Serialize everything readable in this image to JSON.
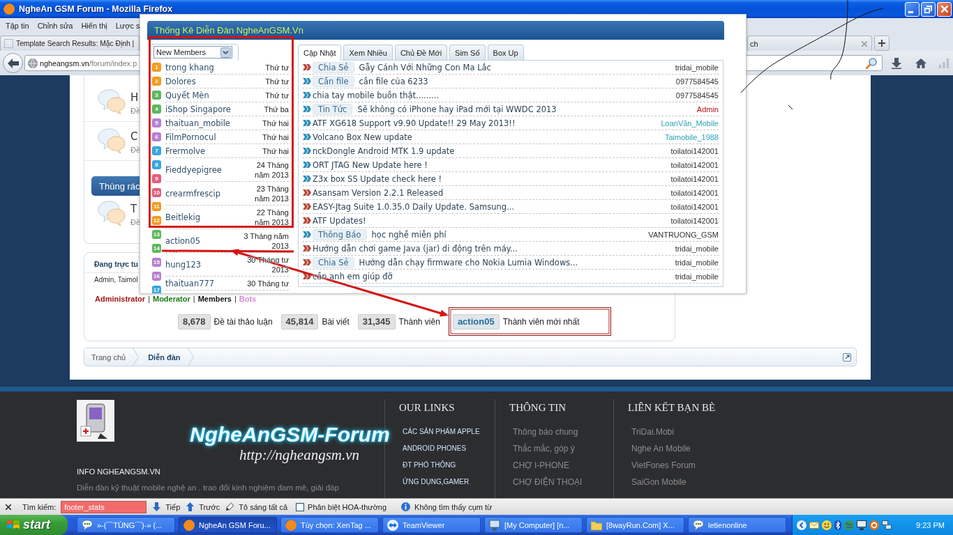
{
  "window": {
    "title": "NgheAn GSM Forum - Mozilla Firefox"
  },
  "menu_bar": [
    "Tập tin",
    "Chỉnh sửa",
    "Hiển thị",
    "Lược s"
  ],
  "browser_tabs": [
    {
      "label": "Template Search Results: Mặc Định |",
      "selected": false
    },
    {
      "label": "ch",
      "selected": false
    }
  ],
  "address_bar": {
    "host": "ngheangsm.vn",
    "path": "/forum/index.p"
  },
  "forum_list": {
    "nodes": [
      {
        "title": "H",
        "meta": "Đề"
      },
      {
        "title": "C",
        "meta": "Đề"
      }
    ],
    "category": {
      "title": "Thùng rác",
      "nodes": [
        {
          "title": "T",
          "meta": "Đề"
        }
      ]
    }
  },
  "online_box": {
    "title": "Đang trực tu",
    "members": "Admin, Taimol"
  },
  "legend": {
    "separator": "|",
    "items": [
      {
        "label": "Administrator",
        "color": "#a31515"
      },
      {
        "label": "Moderator",
        "color": "#1a7a12"
      },
      {
        "label": "Members",
        "color": "#111111"
      },
      {
        "label": "Bots",
        "color": "#d58cd5"
      }
    ]
  },
  "stats": [
    {
      "kind": "count",
      "number": "8,678",
      "caption": "Đề tài thảo luận"
    },
    {
      "kind": "count",
      "number": "45,814",
      "caption": "Bài viết"
    },
    {
      "kind": "count",
      "number": "31,345",
      "caption": "Thành viên"
    },
    {
      "kind": "member",
      "number": "action05",
      "caption": "Thành viên mới nhất"
    }
  ],
  "breadcrumb": [
    {
      "label": "Trang chủ",
      "current": false
    },
    {
      "label": "Diễn đàn",
      "current": true
    }
  ],
  "popup": {
    "title": "Thống Kê Diễn Đàn NgheAnGSM.Vn",
    "dropdown": "New Members",
    "badges": [
      {
        "number": "1",
        "color": "#f29c1f"
      },
      {
        "number": "2",
        "color": "#f29c1f"
      },
      {
        "number": "3",
        "color": "#5cb85c"
      },
      {
        "number": "4",
        "color": "#5cb85c"
      },
      {
        "number": "5",
        "color": "#b77fd1"
      },
      {
        "number": "6",
        "color": "#b77fd1"
      },
      {
        "number": "7",
        "color": "#38a8e0"
      },
      {
        "number": "8",
        "color": "#38a8e0"
      },
      {
        "number": "9",
        "color": "#e0607e"
      },
      {
        "number": "10",
        "color": "#e0607e"
      },
      {
        "number": "11",
        "color": "#f29c1f"
      },
      {
        "number": "12",
        "color": "#f29c1f"
      },
      {
        "number": "13",
        "color": "#5cb85c"
      },
      {
        "number": "14",
        "color": "#5cb85c"
      },
      {
        "number": "15",
        "color": "#b77fd1"
      },
      {
        "number": "16",
        "color": "#b77fd1"
      },
      {
        "number": "17",
        "color": "#38a8e0"
      }
    ],
    "members": [
      {
        "name": "trong khang",
        "date": "Thứ tư"
      },
      {
        "name": "Dolores",
        "date": "Thứ tư"
      },
      {
        "name": "Quyết Mèn",
        "date": "Thứ tư"
      },
      {
        "name": "iShop Singapore",
        "date": "Thứ ba"
      },
      {
        "name": "thaituan_mobile",
        "date": "Thứ hai"
      },
      {
        "name": "FilmPornocul",
        "date": "Thứ hai"
      },
      {
        "name": "Frermolve",
        "date": "Thứ hai"
      },
      {
        "name": "Fieddyepigree",
        "date": "24 Tháng năm 2013"
      },
      {
        "name": "crearmfrescip",
        "date": "23 Tháng năm 2013"
      },
      {
        "name": "Beitlekig",
        "date": "22 Tháng năm 2013"
      },
      {
        "name": "action05",
        "date": "3 Tháng năm 2013"
      },
      {
        "name": "hung123",
        "date": "30 Tháng tư 2013"
      },
      {
        "name": "thaituan777",
        "date": "30 Tháng tư"
      }
    ],
    "tabs": [
      {
        "label": "Cập Nhật",
        "selected": true
      },
      {
        "label": "Xem Nhiều",
        "selected": false
      },
      {
        "label": "Chủ Đề Mới",
        "selected": false
      },
      {
        "label": "Sim Số",
        "selected": false
      },
      {
        "label": "Box Up",
        "selected": false
      }
    ],
    "threads": [
      {
        "color": "#b5483a",
        "prefix": "Chia Sẻ",
        "title": "Gẫy Cánh Với Những Con Ma Lắc",
        "author": {
          "name": "tridai_mobile",
          "color": "#333333"
        }
      },
      {
        "color": "#2d8fb8",
        "prefix": "Cần file",
        "title": "cần file của 6233",
        "author": {
          "name": "0977584545",
          "color": "#333333"
        }
      },
      {
        "color": "#2d8fb8",
        "title": "chia tay mobile buồn thật.........",
        "author": {
          "name": "0977584545",
          "color": "#333333"
        }
      },
      {
        "color": "#2d8fb8",
        "prefix": "Tin Tức",
        "title": "Sẽ không có iPhone hay iPad mới tại WWDC 2013",
        "author": {
          "name": "Admin",
          "color": "#b01010"
        }
      },
      {
        "color": "#2d8fb8",
        "title": "ATF XG618 Support v9.90 Update!! 29 May 2013!!",
        "author": {
          "name": "LoanVăn_Mobile",
          "color": "#2aa3b8"
        }
      },
      {
        "color": "#2d8fb8",
        "title": "Volcano Box New update",
        "author": {
          "name": "Taimobile_1988",
          "color": "#2aa3b8"
        }
      },
      {
        "color": "#2d8fb8",
        "title": "nckDongle Android MTK 1.9 update",
        "author": {
          "name": "toilatoi142001",
          "color": "#333333"
        }
      },
      {
        "color": "#2d8fb8",
        "title": "ORT JTAG New Update here !",
        "author": {
          "name": "toilatoi142001",
          "color": "#333333"
        }
      },
      {
        "color": "#2d8fb8",
        "title": "Z3x box SS Update check here !",
        "author": {
          "name": "toilatoi142001",
          "color": "#333333"
        }
      },
      {
        "color": "#b5483a",
        "title": "Asansam Version 2.2.1 Released",
        "author": {
          "name": "toilatoi142001",
          "color": "#333333"
        }
      },
      {
        "color": "#b5483a",
        "title": "EASY-Jtag Suite 1.0.35.0 Daily Update. Samsung...",
        "author": {
          "name": "toilatoi142001",
          "color": "#333333"
        }
      },
      {
        "color": "#b5483a",
        "title": "ATF Updates!",
        "author": {
          "name": "toilatoi142001",
          "color": "#333333"
        }
      },
      {
        "color": "#2d8fb8",
        "prefix": "Thông Báo",
        "title": "học nghề miễn phí",
        "author": {
          "name": "VANTRUONG_GSM",
          "color": "#333333"
        }
      },
      {
        "color": "#b5483a",
        "title": "Hướng dẫn chơi game Java (jar) di động trên máy...",
        "author": {
          "name": "tridai_mobile",
          "color": "#333333"
        }
      },
      {
        "color": "#b5483a",
        "prefix": "Chia Sẻ",
        "title": "Hướng dẫn chạy firmware cho Nokia Lumia Windows...",
        "author": {
          "name": "tridai_mobile",
          "color": "#333333"
        }
      },
      {
        "color": "#b5483a",
        "title": "cần anh em giúp đỡ",
        "author": {
          "name": "tridai_mobile",
          "color": "#333333"
        }
      }
    ]
  },
  "footer": {
    "brand": "NgheAnGSM-Forum",
    "brand_url": "http://ngheangsm.vn",
    "info_title": "INFO NGHEANGSM.VN",
    "info_text": "Diễn đàn kỹ thuật mobile nghệ an . trao đổi kinh nghiệm đam mê, giải đáp",
    "columns": [
      {
        "kind": "accent",
        "title": "OUR LINKS",
        "links": [
          "CÁC SẢN PHẨM APPLE",
          "ANDROID PHONES",
          "ĐT PHỔ THÔNG",
          "ỨNG DỤNG,GAMER"
        ]
      },
      {
        "kind": "muted",
        "title": "THÔNG TIN",
        "links": [
          "Thông báo chung",
          "Thắc mắc, góp ý",
          "CHỢ I-PHONE",
          "CHỢ ĐIỆN THOẠI"
        ]
      },
      {
        "kind": "muted",
        "title": "LIÊN KẾT BẠN BÈ",
        "links": [
          "TriDai.Mobi",
          "Nghe An Mobile",
          "VietFones Forum",
          "SaiGon Mobile"
        ]
      }
    ]
  },
  "find_bar": {
    "label": "Tìm kiếm:",
    "value": "footer_stats",
    "not_found": true,
    "buttons": [
      {
        "kind": "next",
        "label": "Tiếp"
      },
      {
        "kind": "previous",
        "label": "Trước"
      },
      {
        "kind": "highlight",
        "label": "Tô sáng tất cả"
      }
    ],
    "match_case": {
      "label": "Phân biệt HOA-thường",
      "checked": false
    },
    "status": "Không tìm thấy cụm từ"
  },
  "taskbar": {
    "start": "start",
    "tasks": [
      {
        "kind": "messenger",
        "label": "»-(¯`TÙNG´¯)-» (...",
        "selected": false
      },
      {
        "kind": "browser",
        "label": "NgheAn GSM Foru...",
        "selected": true
      },
      {
        "kind": "browser",
        "label": "Tùy chọn: XenTag ...",
        "selected": false
      },
      {
        "kind": "remote",
        "label": "TeamViewer",
        "selected": false
      },
      {
        "kind": "computer",
        "label": "[My Computer] [n...",
        "selected": false
      },
      {
        "kind": "folder",
        "label": "[8wayRun.Com] X...",
        "selected": false
      },
      {
        "kind": "messenger",
        "label": "letienonline",
        "selected": false
      }
    ],
    "clock": "9:23 PM"
  }
}
